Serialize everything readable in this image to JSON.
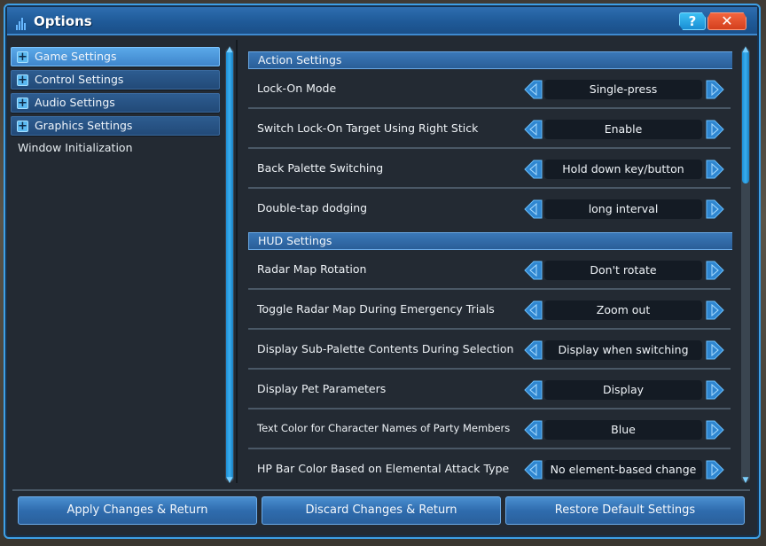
{
  "window": {
    "title": "Options",
    "help_label": "?",
    "close_label": "✕"
  },
  "sidebar": {
    "items": [
      {
        "label": "Game Settings",
        "icon": "plus-icon",
        "active": true
      },
      {
        "label": "Control Settings",
        "icon": "plus-icon",
        "active": false
      },
      {
        "label": "Audio Settings",
        "icon": "plus-icon",
        "active": false
      },
      {
        "label": "Graphics Settings",
        "icon": "plus-icon",
        "active": false
      }
    ],
    "plain_item": "Window Initialization"
  },
  "sections": [
    {
      "header": "Action Settings",
      "settings": [
        {
          "label": "Lock-On Mode",
          "value": "Single-press"
        },
        {
          "label": "Switch Lock-On Target Using Right Stick",
          "value": "Enable"
        },
        {
          "label": "Back Palette Switching",
          "value": "Hold down key/button"
        },
        {
          "label": "Double-tap dodging",
          "value": "long interval"
        }
      ]
    },
    {
      "header": "HUD Settings",
      "settings": [
        {
          "label": "Radar Map Rotation",
          "value": "Don't rotate"
        },
        {
          "label": "Toggle Radar Map During Emergency Trials",
          "value": "Zoom out"
        },
        {
          "label": "Display Sub-Palette Contents During Selection",
          "value": "Display when switching"
        },
        {
          "label": "Display Pet Parameters",
          "value": "Display"
        },
        {
          "label": "Text Color for Character Names of Party Members",
          "value": "Blue"
        },
        {
          "label": "HP Bar Color Based on Elemental Attack Type",
          "value": "No element-based change"
        }
      ]
    }
  ],
  "footer": {
    "apply_label": "Apply Changes & Return",
    "discard_label": "Discard Changes & Return",
    "restore_label": "Restore Default Settings"
  },
  "scroll": {
    "right_panel_visible_fraction": 0.31,
    "right_panel_position": 0.0
  }
}
